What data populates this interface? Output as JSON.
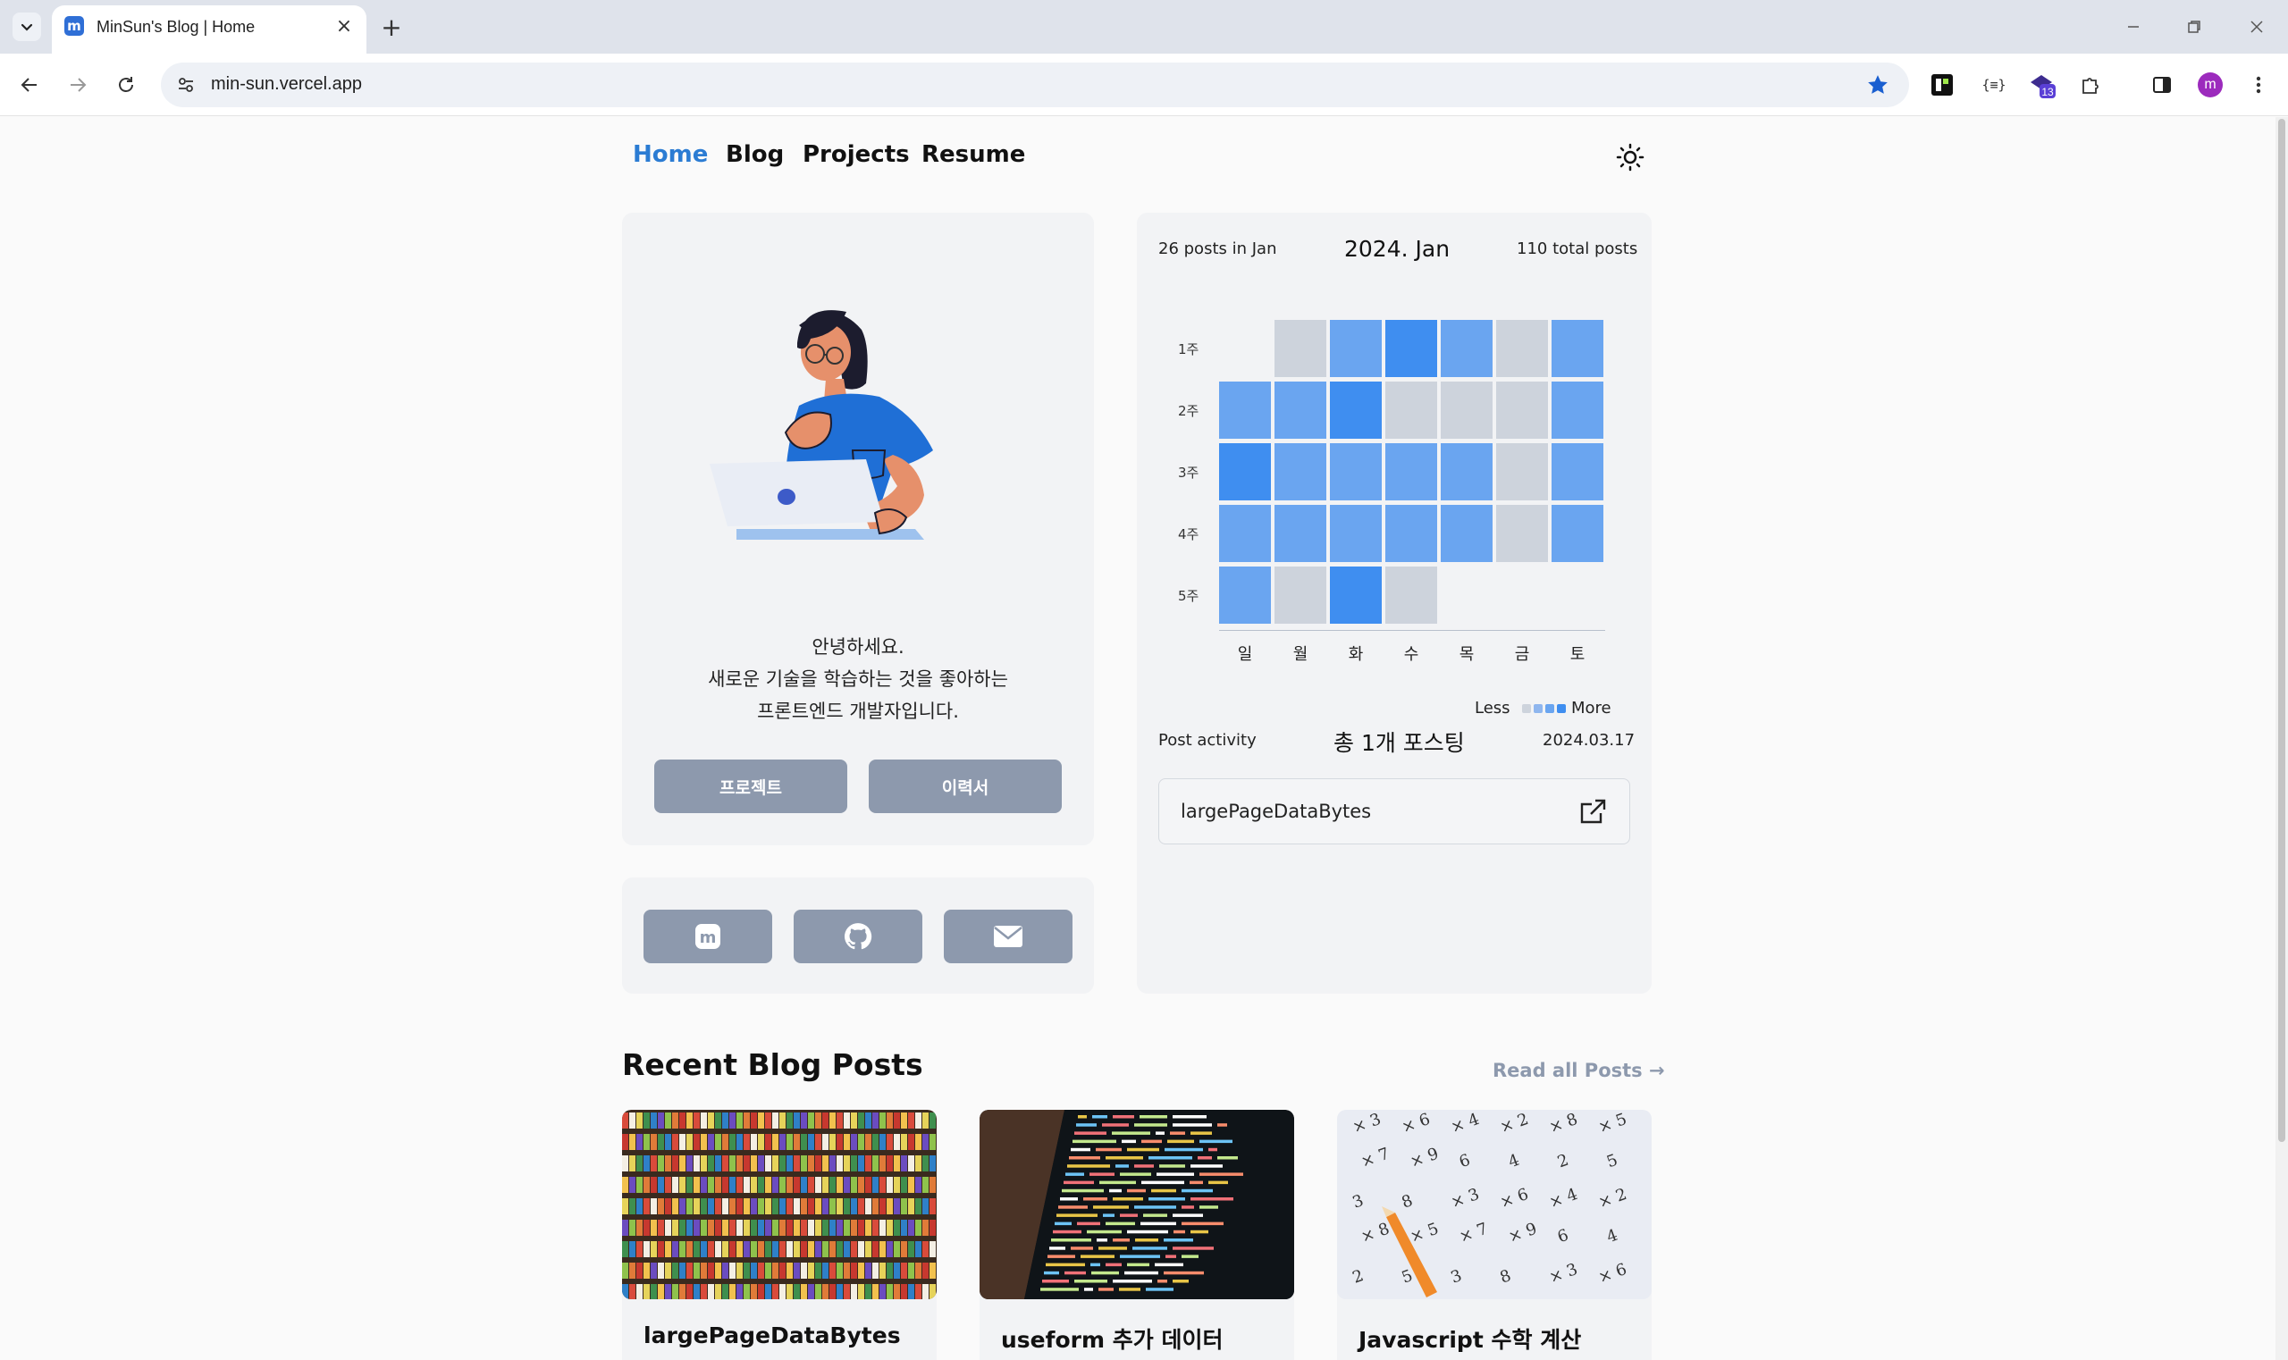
{
  "browser": {
    "tab_title": "MinSun's Blog | Home",
    "favicon_letter": "m",
    "url": "min-sun.vercel.app",
    "extension_badge": "13",
    "profile_letter": "m"
  },
  "nav": {
    "items": [
      {
        "label": "Home",
        "active": true
      },
      {
        "label": "Blog",
        "active": false
      },
      {
        "label": "Projects",
        "active": false
      },
      {
        "label": "Resume",
        "active": false
      }
    ]
  },
  "profile": {
    "greeting_line1": "안녕하세요.",
    "greeting_line2": "새로운 기술을 학습하는 것을 좋아하는",
    "greeting_line3": "프론트엔드 개발자입니다.",
    "projects_button": "프로젝트",
    "resume_button": "이력서"
  },
  "social": [
    "medium-icon",
    "github-icon",
    "mail-icon"
  ],
  "calendar": {
    "posts_in_month": "26 posts in Jan",
    "title": "2024. Jan",
    "total_posts": "110 total posts",
    "weeks": [
      "1주",
      "2주",
      "3주",
      "4주",
      "5주"
    ],
    "days": [
      "일",
      "월",
      "화",
      "수",
      "목",
      "금",
      "토"
    ],
    "grid": [
      [
        null,
        0,
        2,
        3,
        2,
        0,
        2
      ],
      [
        2,
        2,
        3,
        0,
        0,
        0,
        2
      ],
      [
        3,
        2,
        2,
        2,
        2,
        0,
        2
      ],
      [
        2,
        2,
        2,
        2,
        2,
        0,
        2
      ],
      [
        2,
        0,
        3,
        null,
        null,
        null,
        null
      ]
    ],
    "grid_fifth_row_blank": [
      false,
      false,
      false,
      true,
      null,
      null,
      null
    ],
    "legend_less": "Less",
    "legend_more": "More",
    "colors": {
      "level0": "#cdd3dc",
      "level1": "#8fb6ee",
      "level2": "#6aa5f0",
      "level3": "#3f8ef0"
    },
    "activity_label": "Post activity",
    "activity_count": "총 1개 포스팅",
    "activity_date": "2024.03.17",
    "activity_post": "largePageDataBytes"
  },
  "recent": {
    "title": "Recent Blog Posts",
    "read_all": "Read all Posts →",
    "posts": [
      {
        "title": "largePageDataBytes",
        "thumb": "grocery-shelves-image"
      },
      {
        "title": "useform 추가 데이터",
        "thumb": "code-screen-image"
      },
      {
        "title": "Javascript 수학 계산",
        "thumb": "math-paper-image"
      }
    ]
  }
}
